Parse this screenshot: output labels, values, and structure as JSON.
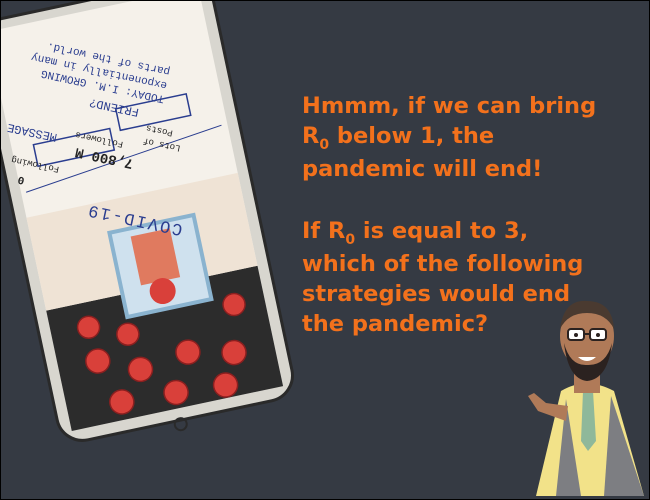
{
  "speech": {
    "line1_pre": "Hmmm, if we can bring R",
    "line1_sub": "0",
    "line1_post": " below 1, the pandemic will end!",
    "line2_pre": "If R",
    "line2_sub": "0",
    "line2_post": " is equal to 3, which of the following strategies would end the pandemic?"
  },
  "phone_profile": {
    "name": "COVID-19",
    "followers_value": "7,800 M",
    "followers_label": "Followers",
    "following_value": "0",
    "following_label": "Following",
    "posts_value": "Lots of",
    "posts_label": "Posts",
    "message_button": "MESSAGE",
    "friend_button": "FRIEND?",
    "bio": "TODAY: I.M. GROWING exponentially in many parts of the world."
  },
  "colors": {
    "background": "#353a43",
    "accent_text": "#f3711c",
    "phone_frame": "#d8d6cf",
    "phone_screen": "#2c2c2c",
    "virus": "#d9403a"
  }
}
